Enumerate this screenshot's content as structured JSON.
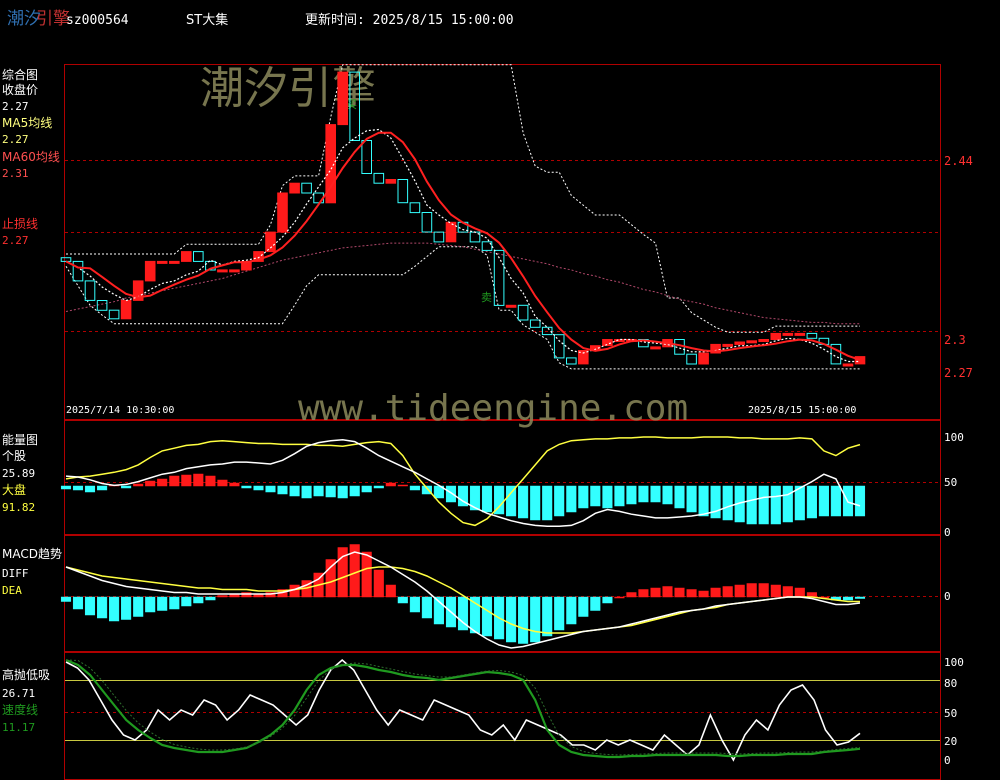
{
  "header": {
    "logo_left": "潮汐",
    "logo_right": "引擎",
    "code": "sz000564",
    "name": "ST大集",
    "update_label": "更新时间: 2025/8/15 15:00:00"
  },
  "watermark": {
    "cn": "潮汐引擎",
    "url": "www.tideengine.com"
  },
  "colors": {
    "up": "#ff1a1a",
    "down": "#33ffff",
    "ma5": "#ffffff",
    "ma60": "#d2383e",
    "grid_red": "#b00000",
    "yellow": "#ffff40",
    "green": "#1f9a1f"
  },
  "panels": {
    "main": {
      "title": "综合图",
      "close_label": "收盘价",
      "close_value": "2.27",
      "ma5_label": "MA5均线",
      "ma5_value": "2.27",
      "ma60_label": "MA60均线",
      "ma60_value": "2.31",
      "stop_label": "止损线",
      "stop_value": "2.27",
      "date_start": "2025/7/14 10:30:00",
      "date_end": "2025/8/15 15:00:00",
      "buy_mark": "买",
      "sell_mark": "卖",
      "ticks": [
        "2.44",
        "2.3",
        "2.27"
      ]
    },
    "energy": {
      "title": "能量图",
      "stock_label": "个股",
      "stock_value": "25.89",
      "market_label": "大盘",
      "market_value": "91.82",
      "ticks": [
        "100",
        "50",
        "0"
      ]
    },
    "macd": {
      "title": "MACD趋势",
      "diff_label": "DIFF",
      "dea_label": "DEA",
      "ticks": [
        "0"
      ]
    },
    "osc": {
      "title": "高抛低吸",
      "value": "26.71",
      "speed_label": "速度线",
      "speed_value": "11.17",
      "ticks": [
        "100",
        "80",
        "50",
        "20",
        "0"
      ]
    }
  },
  "chart_data": {
    "type": "candlestick",
    "bars": 67,
    "price_ticks": [
      2.44,
      2.3,
      2.27
    ],
    "close": [
      2.357,
      2.341,
      2.325,
      2.317,
      2.31,
      2.325,
      2.341,
      2.357,
      2.357,
      2.357,
      2.365,
      2.357,
      2.35,
      2.35,
      2.35,
      2.357,
      2.365,
      2.381,
      2.413,
      2.421,
      2.413,
      2.405,
      2.469,
      2.512,
      2.456,
      2.429,
      2.421,
      2.424,
      2.405,
      2.397,
      2.381,
      2.373,
      2.389,
      2.381,
      2.373,
      2.366,
      2.321,
      2.321,
      2.309,
      2.303,
      2.297,
      2.278,
      2.273,
      2.284,
      2.288,
      2.293,
      2.293,
      2.293,
      2.287,
      2.287,
      2.293,
      2.281,
      2.273,
      2.282,
      2.289,
      2.289,
      2.291,
      2.292,
      2.293,
      2.298,
      2.298,
      2.298,
      2.294,
      2.289,
      2.273,
      2.273,
      2.279
    ],
    "ma5": [
      2.357,
      2.352,
      2.345,
      2.336,
      2.33,
      2.325,
      2.328,
      2.334,
      2.339,
      2.341,
      2.346,
      2.349,
      2.358,
      2.354,
      2.357,
      2.358,
      2.36,
      2.368,
      2.377,
      2.389,
      2.404,
      2.418,
      2.432,
      2.45,
      2.458,
      2.464,
      2.465,
      2.458,
      2.441,
      2.423,
      2.403,
      2.395,
      2.388,
      2.383,
      2.381,
      2.376,
      2.36,
      2.343,
      2.331,
      2.312,
      2.303,
      2.292,
      2.284,
      2.282,
      2.285,
      2.289,
      2.293,
      2.293,
      2.291,
      2.29,
      2.289,
      2.286,
      2.283,
      2.283,
      2.284,
      2.286,
      2.288,
      2.288,
      2.289,
      2.292,
      2.294,
      2.293,
      2.29,
      2.285,
      2.279,
      2.275,
      2.275
    ],
    "ma60": [
      2.316,
      2.318,
      2.32,
      2.322,
      2.324,
      2.327,
      2.329,
      2.331,
      2.333,
      2.335,
      2.337,
      2.339,
      2.341,
      2.343,
      2.346,
      2.349,
      2.352,
      2.355,
      2.358,
      2.36,
      2.362,
      2.364,
      2.366,
      2.368,
      2.369,
      2.37,
      2.371,
      2.372,
      2.372,
      2.372,
      2.372,
      2.371,
      2.37,
      2.369,
      2.367,
      2.365,
      2.363,
      2.361,
      2.359,
      2.357,
      2.355,
      2.352,
      2.35,
      2.347,
      2.345,
      2.342,
      2.34,
      2.337,
      2.334,
      2.332,
      2.329,
      2.326,
      2.324,
      2.322,
      2.319,
      2.317,
      2.315,
      2.313,
      2.311,
      2.31,
      2.309,
      2.308,
      2.307,
      2.307,
      2.306,
      2.306,
      2.306
    ],
    "energy_stock": [
      58,
      57,
      54,
      50,
      48,
      49,
      52,
      56,
      60,
      62,
      66,
      68,
      70,
      71,
      73,
      73,
      72,
      71,
      75,
      82,
      90,
      94,
      96,
      97,
      95,
      88,
      80,
      74,
      68,
      62,
      55,
      48,
      40,
      31,
      24,
      18,
      14,
      10,
      7,
      5,
      4,
      4,
      5,
      10,
      18,
      22,
      20,
      17,
      15,
      13,
      13,
      14,
      15,
      17,
      20,
      25,
      29,
      32,
      35,
      36,
      38,
      45,
      52,
      60,
      55,
      30,
      25.89
    ],
    "energy_market": [
      55,
      57,
      58,
      60,
      62,
      65,
      70,
      78,
      85,
      88,
      91,
      92,
      95,
      96,
      95,
      94,
      93,
      93,
      92,
      92,
      92,
      91,
      91,
      90,
      92,
      94,
      95,
      93,
      80,
      60,
      45,
      30,
      18,
      8,
      5,
      12,
      25,
      40,
      55,
      70,
      85,
      92,
      96,
      97,
      98,
      98,
      99,
      99,
      100,
      100,
      99,
      99,
      99,
      100,
      100,
      100,
      99,
      99,
      98,
      98,
      98,
      99,
      98,
      85,
      80,
      88,
      91.82
    ],
    "energy_bars": [
      -3,
      -4,
      -6,
      -4,
      1,
      -2,
      2,
      5,
      7,
      10,
      11,
      12,
      10,
      6,
      3,
      -2,
      -4,
      -6,
      -8,
      -10,
      -12,
      -10,
      -11,
      -12,
      -10,
      -6,
      -2,
      3,
      1,
      -4,
      -8,
      -12,
      -16,
      -20,
      -24,
      -26,
      -28,
      -30,
      -32,
      -34,
      -34,
      -30,
      -26,
      -22,
      -20,
      -22,
      -20,
      -18,
      -16,
      -16,
      -18,
      -22,
      -26,
      -30,
      -32,
      -34,
      -36,
      -38,
      -38,
      -38,
      -36,
      -34,
      -32,
      -30,
      -30,
      -30,
      -30
    ],
    "macd_bars": [
      -0.3,
      -0.8,
      -1.2,
      -1.4,
      -1.6,
      -1.5,
      -1.3,
      -1.0,
      -0.9,
      -0.8,
      -0.6,
      -0.4,
      -0.2,
      0.1,
      0.2,
      0.3,
      0.2,
      0.3,
      0.5,
      0.8,
      1.1,
      1.6,
      2.5,
      3.3,
      3.5,
      3.0,
      1.8,
      0.8,
      -0.4,
      -1.0,
      -1.4,
      -1.8,
      -2.0,
      -2.2,
      -2.4,
      -2.6,
      -2.8,
      -3.0,
      -3.1,
      -3.0,
      -2.6,
      -2.2,
      -1.8,
      -1.3,
      -0.9,
      -0.4,
      0.0,
      0.3,
      0.5,
      0.6,
      0.7,
      0.6,
      0.5,
      0.4,
      0.6,
      0.7,
      0.8,
      0.9,
      0.9,
      0.8,
      0.7,
      0.6,
      0.3,
      0.0,
      -0.2,
      -0.2,
      -0.1
    ],
    "macd_diff": [
      2.0,
      1.7,
      1.4,
      1.1,
      0.9,
      0.7,
      0.6,
      0.5,
      0.4,
      0.3,
      0.3,
      0.2,
      0.2,
      0.2,
      0.2,
      0.2,
      0.2,
      0.2,
      0.3,
      0.5,
      0.8,
      1.2,
      2.0,
      2.7,
      3.0,
      2.8,
      2.4,
      2.0,
      1.5,
      1.0,
      0.4,
      -0.3,
      -1.0,
      -1.7,
      -2.3,
      -2.8,
      -3.2,
      -3.4,
      -3.3,
      -3.1,
      -2.9,
      -2.7,
      -2.5,
      -2.3,
      -2.2,
      -2.1,
      -2.0,
      -1.8,
      -1.6,
      -1.4,
      -1.2,
      -1.0,
      -0.9,
      -0.8,
      -0.6,
      -0.5,
      -0.4,
      -0.3,
      -0.2,
      -0.1,
      0.0,
      0.0,
      -0.1,
      -0.3,
      -0.5,
      -0.5,
      -0.4
    ],
    "macd_dea": [
      2.0,
      1.8,
      1.6,
      1.4,
      1.3,
      1.2,
      1.1,
      1.0,
      0.9,
      0.8,
      0.7,
      0.6,
      0.6,
      0.5,
      0.5,
      0.5,
      0.4,
      0.4,
      0.4,
      0.5,
      0.6,
      0.8,
      1.0,
      1.3,
      1.6,
      1.9,
      2.0,
      2.0,
      1.9,
      1.7,
      1.4,
      1.0,
      0.6,
      0.1,
      -0.4,
      -0.9,
      -1.4,
      -1.8,
      -2.1,
      -2.3,
      -2.4,
      -2.4,
      -2.4,
      -2.3,
      -2.2,
      -2.1,
      -2.0,
      -1.9,
      -1.7,
      -1.5,
      -1.3,
      -1.1,
      -0.9,
      -0.8,
      -0.7,
      -0.5,
      -0.4,
      -0.3,
      -0.2,
      -0.1,
      0.0,
      0.0,
      0.0,
      -0.1,
      -0.2,
      -0.3,
      -0.3
    ],
    "osc_white": [
      98,
      92,
      80,
      60,
      40,
      25,
      20,
      30,
      50,
      40,
      50,
      45,
      60,
      55,
      40,
      50,
      65,
      60,
      55,
      45,
      35,
      45,
      70,
      90,
      100,
      90,
      70,
      50,
      35,
      50,
      45,
      40,
      60,
      55,
      50,
      45,
      30,
      25,
      35,
      20,
      40,
      35,
      30,
      25,
      15,
      15,
      10,
      20,
      15,
      20,
      15,
      10,
      25,
      15,
      5,
      15,
      45,
      20,
      0,
      25,
      40,
      30,
      55,
      70,
      75,
      60,
      30,
      15,
      18,
      26.71
    ],
    "osc_speed": [
      100,
      95,
      85,
      70,
      55,
      40,
      30,
      22,
      15,
      12,
      10,
      8,
      8,
      8,
      10,
      12,
      18,
      25,
      35,
      50,
      70,
      85,
      92,
      95,
      95,
      93,
      90,
      88,
      85,
      83,
      82,
      80,
      82,
      84,
      86,
      88,
      87,
      85,
      80,
      60,
      30,
      15,
      8,
      5,
      4,
      3,
      3,
      4,
      4,
      5,
      5,
      5,
      5,
      5,
      5,
      4,
      4,
      5,
      5,
      5,
      6,
      6,
      6,
      8,
      9,
      10,
      11.17
    ]
  }
}
